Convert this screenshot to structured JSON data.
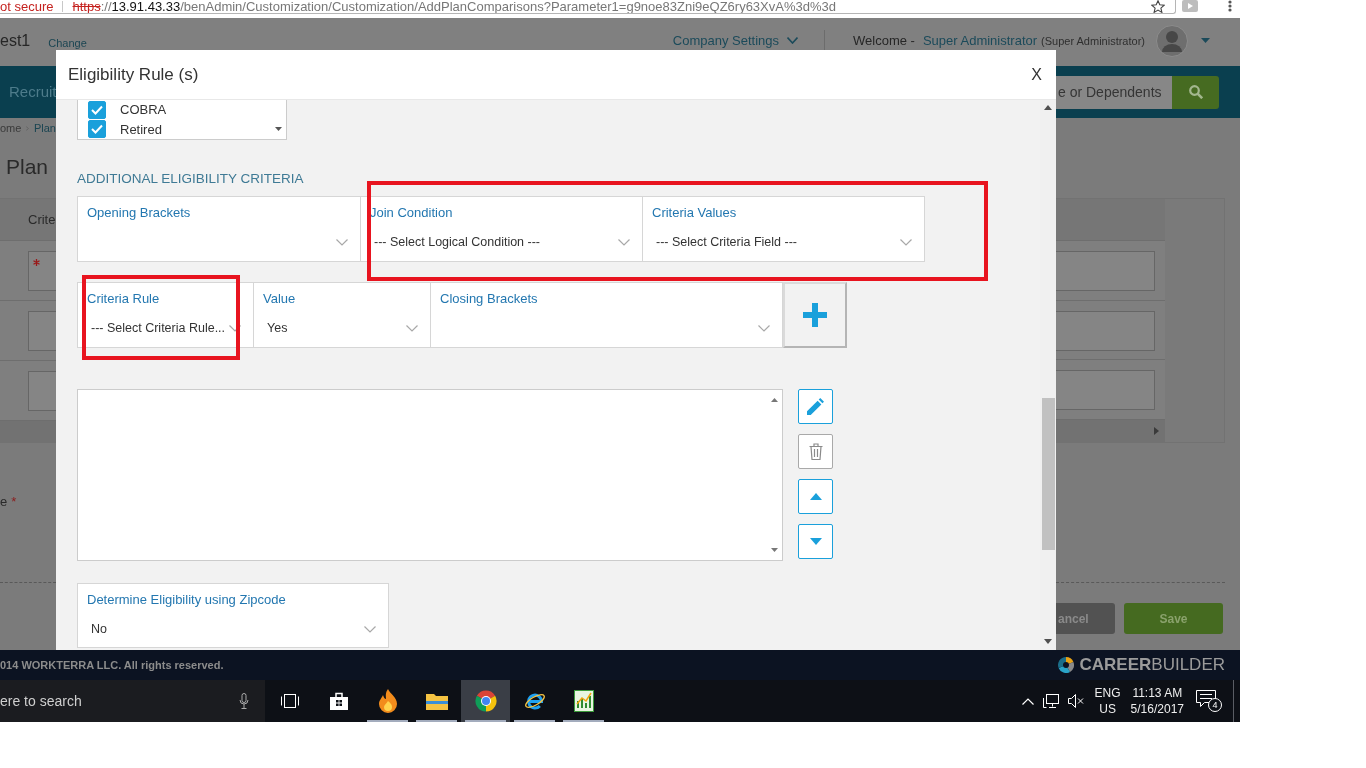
{
  "address_bar": {
    "security_label": "ot secure",
    "url": [
      {
        "kind": "scheme",
        "text": "https"
      },
      {
        "kind": "plain",
        "text": "://"
      },
      {
        "kind": "host",
        "text": "13.91.43.33"
      },
      {
        "kind": "plain",
        "text": "/benAdmin/Customization/Customization/AddPlanComparisons?Parameter1=g9noe83Zni9eQZ6ry63XvA%3d%3d"
      }
    ]
  },
  "header": {
    "account_name": "est1",
    "change_link": "Change",
    "settings_menu": "Company Settings",
    "welcome_label": "Welcome -",
    "user_name": "Super Administrator",
    "user_role": "(Super Administrator)"
  },
  "nav": {
    "menu_item": "Recruit",
    "search": {
      "placeholder": "e or Dependents"
    }
  },
  "page": {
    "breadcrumb": [
      {
        "kind": "text",
        "label": "ome"
      },
      {
        "kind": "link",
        "label": "Plan"
      }
    ],
    "title": "Plan",
    "table_header": "Crite",
    "table_rows": [
      {
        "required": true
      },
      {
        "required": false
      },
      {
        "required": false
      }
    ],
    "required_label": "e",
    "required_mark": "*",
    "cancel_button": "ancel",
    "save_button": "Save"
  },
  "modal": {
    "title": "Eligibility Rule (s)",
    "close": "X",
    "status_list": [
      {
        "label": "COBRA",
        "checked": true
      },
      {
        "label": "Retired",
        "checked": true
      }
    ],
    "section_heading": "ADDITIONAL ELIGIBILITY CRITERIA",
    "criteria_rows": [
      {
        "fields": [
          {
            "label": "Opening Brackets"
          },
          {
            "label": "Join Condition",
            "value": "--- Select Logical Condition ---"
          },
          {
            "label": "Criteria Values",
            "value": "--- Select Criteria Field ---"
          }
        ],
        "has_add_button": false
      },
      {
        "fields": [
          {
            "label": "Criteria Rule",
            "value": "--- Select Criteria Rule..."
          },
          {
            "label": "Value",
            "value": "Yes"
          },
          {
            "label": "Closing Brackets"
          }
        ],
        "has_add_button": true
      }
    ],
    "rule_actions": [
      {
        "kind": "edit",
        "disabled": false
      },
      {
        "kind": "delete",
        "disabled": true
      },
      {
        "kind": "up",
        "disabled": false
      },
      {
        "kind": "down",
        "disabled": false
      }
    ],
    "zipcode_field": {
      "label": "Determine Eligibility using Zipcode",
      "value": "No"
    }
  },
  "footer": {
    "copyright": "014 WORKTERRA LLC. All rights reserved.",
    "logo_text": "**CAREER**BUILDER"
  },
  "taskbar": {
    "search": {
      "placeholder": "ere to search"
    },
    "apps": [
      {
        "kind": "taskview",
        "open": false,
        "selected": false
      },
      {
        "kind": "store",
        "open": false,
        "selected": false
      },
      {
        "kind": "flame",
        "open": true,
        "selected": false
      },
      {
        "kind": "folder",
        "open": true,
        "selected": false
      },
      {
        "kind": "ring",
        "open": true,
        "selected": true
      },
      {
        "kind": "letter",
        "open": true,
        "selected": false
      },
      {
        "kind": "chart",
        "open": true,
        "selected": false
      }
    ],
    "language": "ENG",
    "region": "US",
    "time": "11:13 AM",
    "date": "5/16/2017",
    "notifications": "4"
  }
}
